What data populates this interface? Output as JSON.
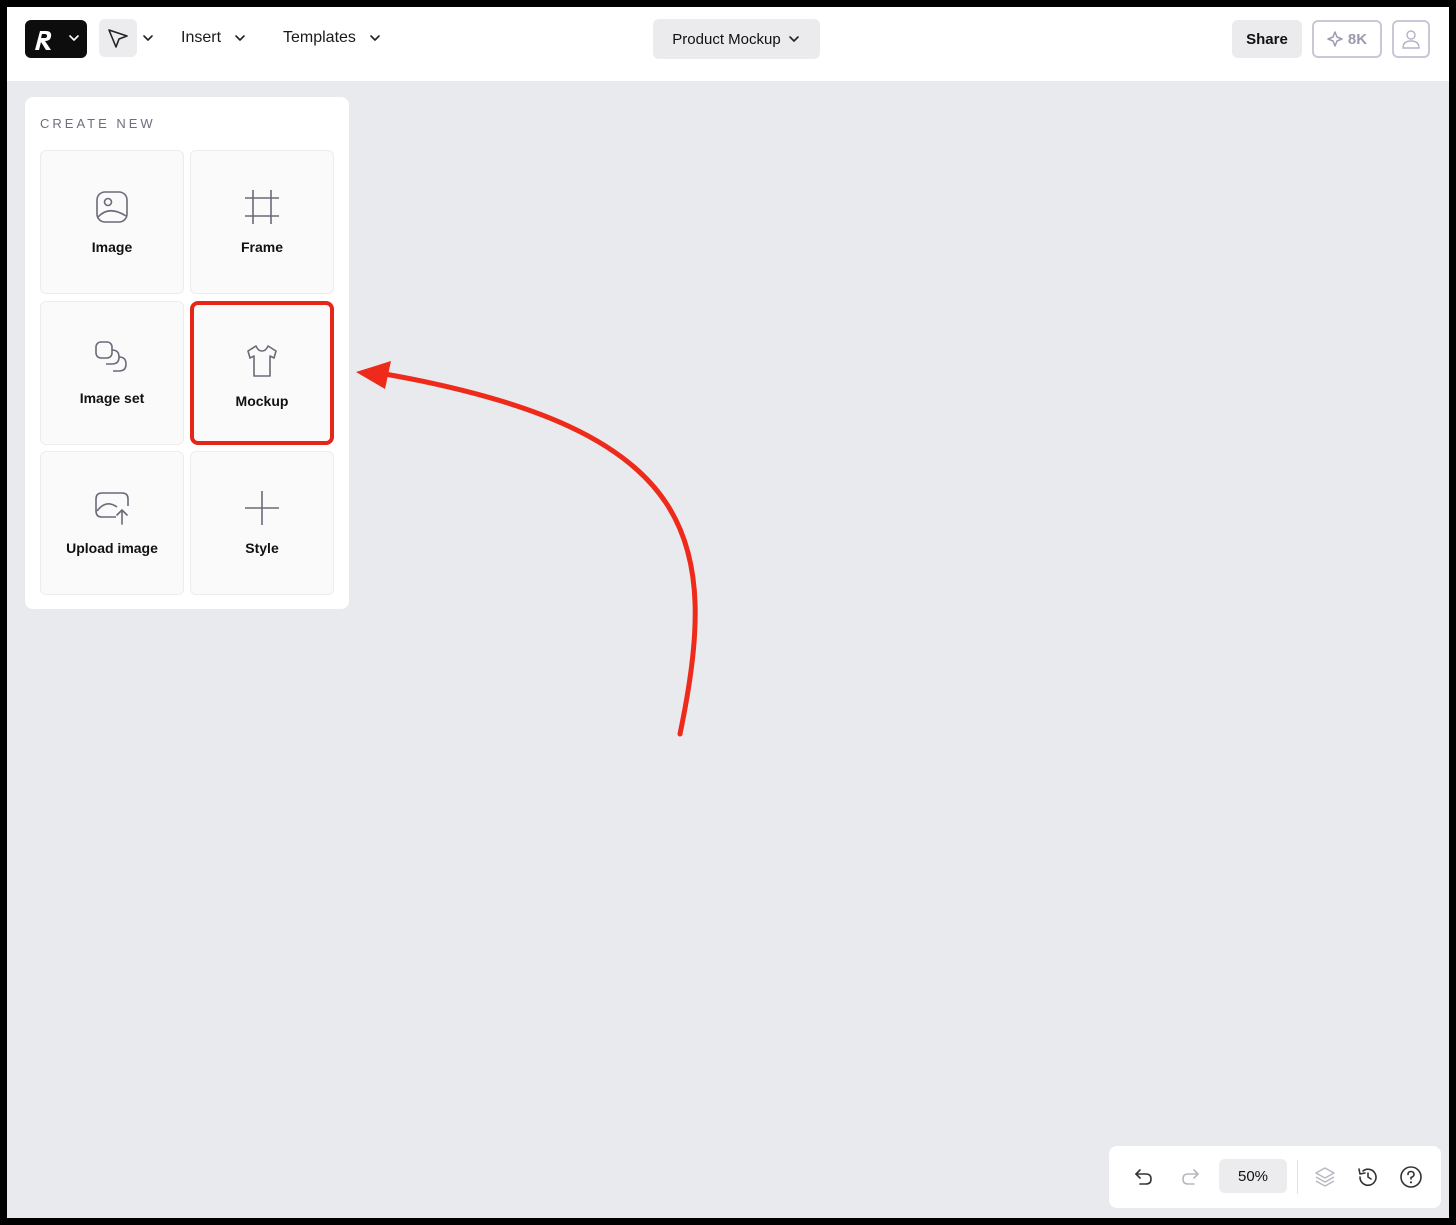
{
  "header": {
    "insert_label": "Insert",
    "templates_label": "Templates",
    "doc_title": "Product Mockup",
    "share_label": "Share",
    "credits": "8K"
  },
  "panel": {
    "heading": "CREATE NEW",
    "tiles": [
      {
        "label": "Image",
        "icon": "image-icon"
      },
      {
        "label": "Frame",
        "icon": "frame-icon"
      },
      {
        "label": "Image set",
        "icon": "image-set-icon"
      },
      {
        "label": "Mockup",
        "icon": "tshirt-icon"
      },
      {
        "label": "Upload image",
        "icon": "upload-image-icon"
      },
      {
        "label": "Style",
        "icon": "plus-icon"
      }
    ]
  },
  "toolbar": {
    "zoom": "50%"
  },
  "colors": {
    "canvas": "#e9eaee",
    "highlight": "#e7261a",
    "logo_bg": "#0d0d0d"
  }
}
